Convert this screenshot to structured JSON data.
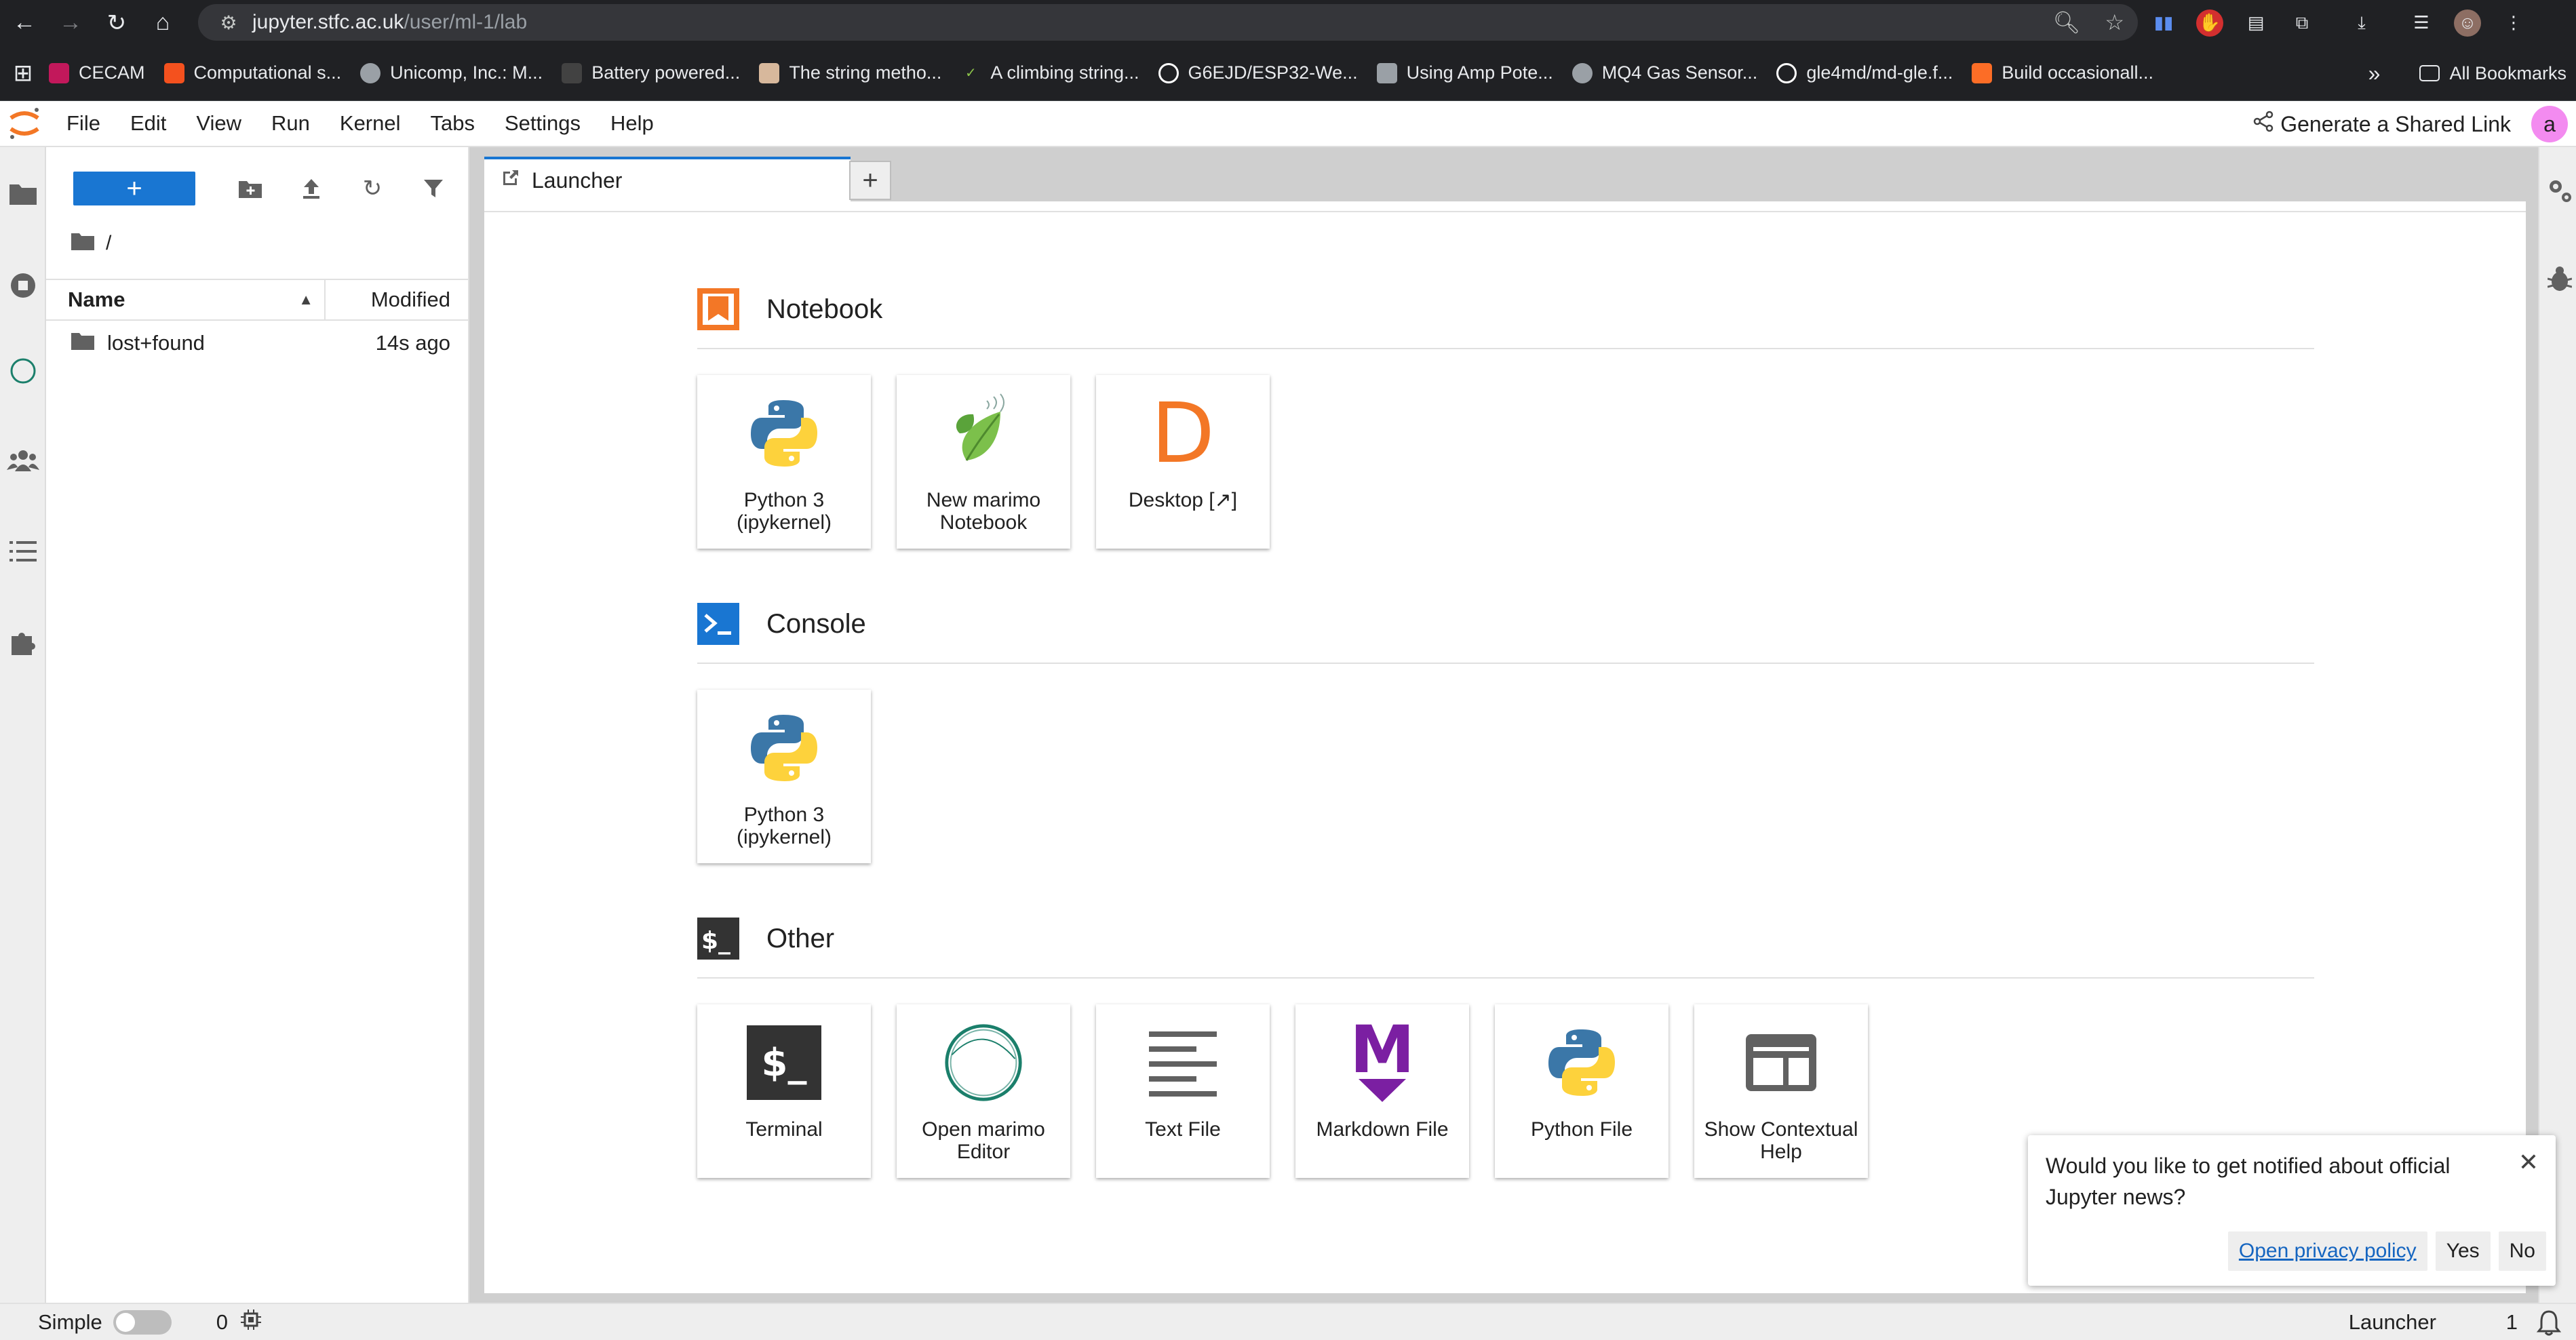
{
  "browser": {
    "url_host": "jupyter.stfc.ac.uk",
    "url_path": "/user/ml-1/lab",
    "bookmarks": [
      {
        "label": "CECAM",
        "icon": "cecam-icon",
        "color": "#c2185b"
      },
      {
        "label": "Computational s...",
        "icon": "f-icon",
        "color": "#f4511e"
      },
      {
        "label": "Unicomp, Inc.: M...",
        "icon": "globe-icon",
        "color": "#9aa0a6"
      },
      {
        "label": "Battery powered...",
        "icon": "battery-icon",
        "color": "#424242"
      },
      {
        "label": "The string metho...",
        "icon": "page-icon",
        "color": "#d7b89c"
      },
      {
        "label": "A climbing string...",
        "icon": "check-icon",
        "color": "#8bc34a"
      },
      {
        "label": "G6EJD/ESP32-We...",
        "icon": "github-icon",
        "color": "#ffffff"
      },
      {
        "label": "Using Amp Pote...",
        "icon": "building-icon",
        "color": "#9aa0a6"
      },
      {
        "label": "MQ4 Gas Sensor...",
        "icon": "globe-icon",
        "color": "#9aa0a6"
      },
      {
        "label": "gle4md/md-gle.f...",
        "icon": "github-icon",
        "color": "#ffffff"
      },
      {
        "label": "Build occasionall...",
        "icon": "gitlab-icon",
        "color": "#fc6d26"
      }
    ],
    "all_bookmarks": "All Bookmarks"
  },
  "menubar": {
    "items": [
      "File",
      "Edit",
      "View",
      "Run",
      "Kernel",
      "Tabs",
      "Settings",
      "Help"
    ],
    "share_label": "Generate a Shared Link",
    "avatar_letter": "a"
  },
  "filebrowser": {
    "new_label": "+",
    "breadcrumb": "/",
    "col_name": "Name",
    "col_modified": "Modified",
    "rows": [
      {
        "name": "lost+found",
        "modified": "14s ago"
      }
    ]
  },
  "tabs": {
    "active_label": "Launcher",
    "add_label": "+"
  },
  "launcher": {
    "sections": [
      {
        "title": "Notebook",
        "cards": [
          {
            "label": "Python 3 (ipykernel)",
            "icon": "python-logo-icon"
          },
          {
            "label": "New marimo Notebook",
            "icon": "marimo-leaf-icon"
          },
          {
            "label": "Desktop [↗]",
            "icon": "desktop-d-icon"
          }
        ]
      },
      {
        "title": "Console",
        "cards": [
          {
            "label": "Python 3 (ipykernel)",
            "icon": "python-logo-icon"
          }
        ]
      },
      {
        "title": "Other",
        "cards": [
          {
            "label": "Terminal",
            "icon": "terminal-icon"
          },
          {
            "label": "Open marimo Editor",
            "icon": "marimo-ring-icon"
          },
          {
            "label": "Text File",
            "icon": "text-file-icon"
          },
          {
            "label": "Markdown File",
            "icon": "markdown-icon"
          },
          {
            "label": "Python File",
            "icon": "python-logo-icon"
          },
          {
            "label": "Show Contextual Help",
            "icon": "contextual-help-icon"
          }
        ]
      }
    ],
    "terminal_glyph": "$_",
    "markdown_glyph": "M",
    "desktop_glyph": "D"
  },
  "notification": {
    "message": "Would you like to get notified about official Jupyter news?",
    "privacy_link": "Open privacy policy",
    "yes": "Yes",
    "no": "No",
    "close": "✕"
  },
  "statusbar": {
    "mode_label": "Simple",
    "kernel_count": "0",
    "right_label": "Launcher",
    "right_count": "1"
  },
  "colors": {
    "accent": "#1976d2",
    "notebook_orange": "#f37726",
    "console_blue": "#1976d2",
    "other_dark": "#333333",
    "markdown_purple": "#7b1fa2"
  }
}
